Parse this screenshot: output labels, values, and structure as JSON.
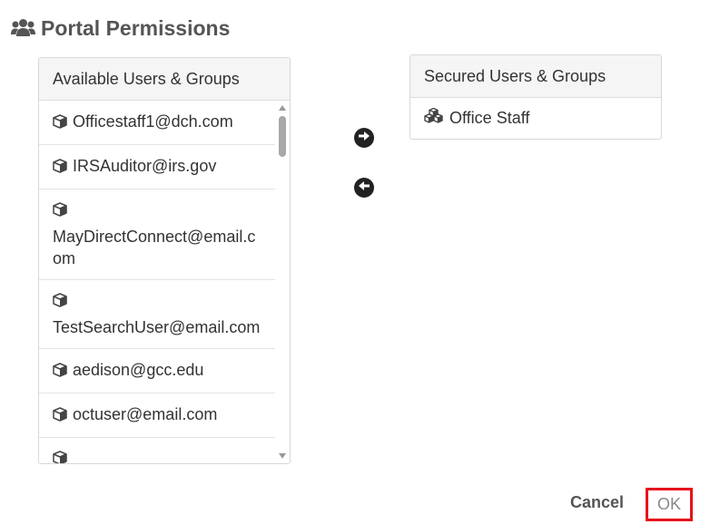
{
  "dialog": {
    "title": "Portal Permissions"
  },
  "available": {
    "header": "Available Users & Groups",
    "items": [
      {
        "label": "Officestaff1@dch.com",
        "wrap": false
      },
      {
        "label": "IRSAuditor@irs.gov",
        "wrap": false
      },
      {
        "label": "MayDirectConnect@email.com",
        "wrap": true
      },
      {
        "label": "TestSearchUser@email.com",
        "wrap": true
      },
      {
        "label": "aedison@gcc.edu",
        "wrap": false
      },
      {
        "label": "octuser@email.com",
        "wrap": false
      },
      {
        "label": "",
        "wrap": true
      }
    ]
  },
  "secured": {
    "header": "Secured Users & Groups",
    "items": [
      {
        "label": "Office Staff"
      }
    ]
  },
  "buttons": {
    "cancel": "Cancel",
    "ok": "OK"
  },
  "icons": {
    "title": "users-icon",
    "user_item": "cube-icon",
    "group_item": "cubes-icon",
    "add": "arrow-circle-right-icon",
    "remove": "arrow-circle-left-icon"
  },
  "colors": {
    "highlight": "#e8101b"
  }
}
